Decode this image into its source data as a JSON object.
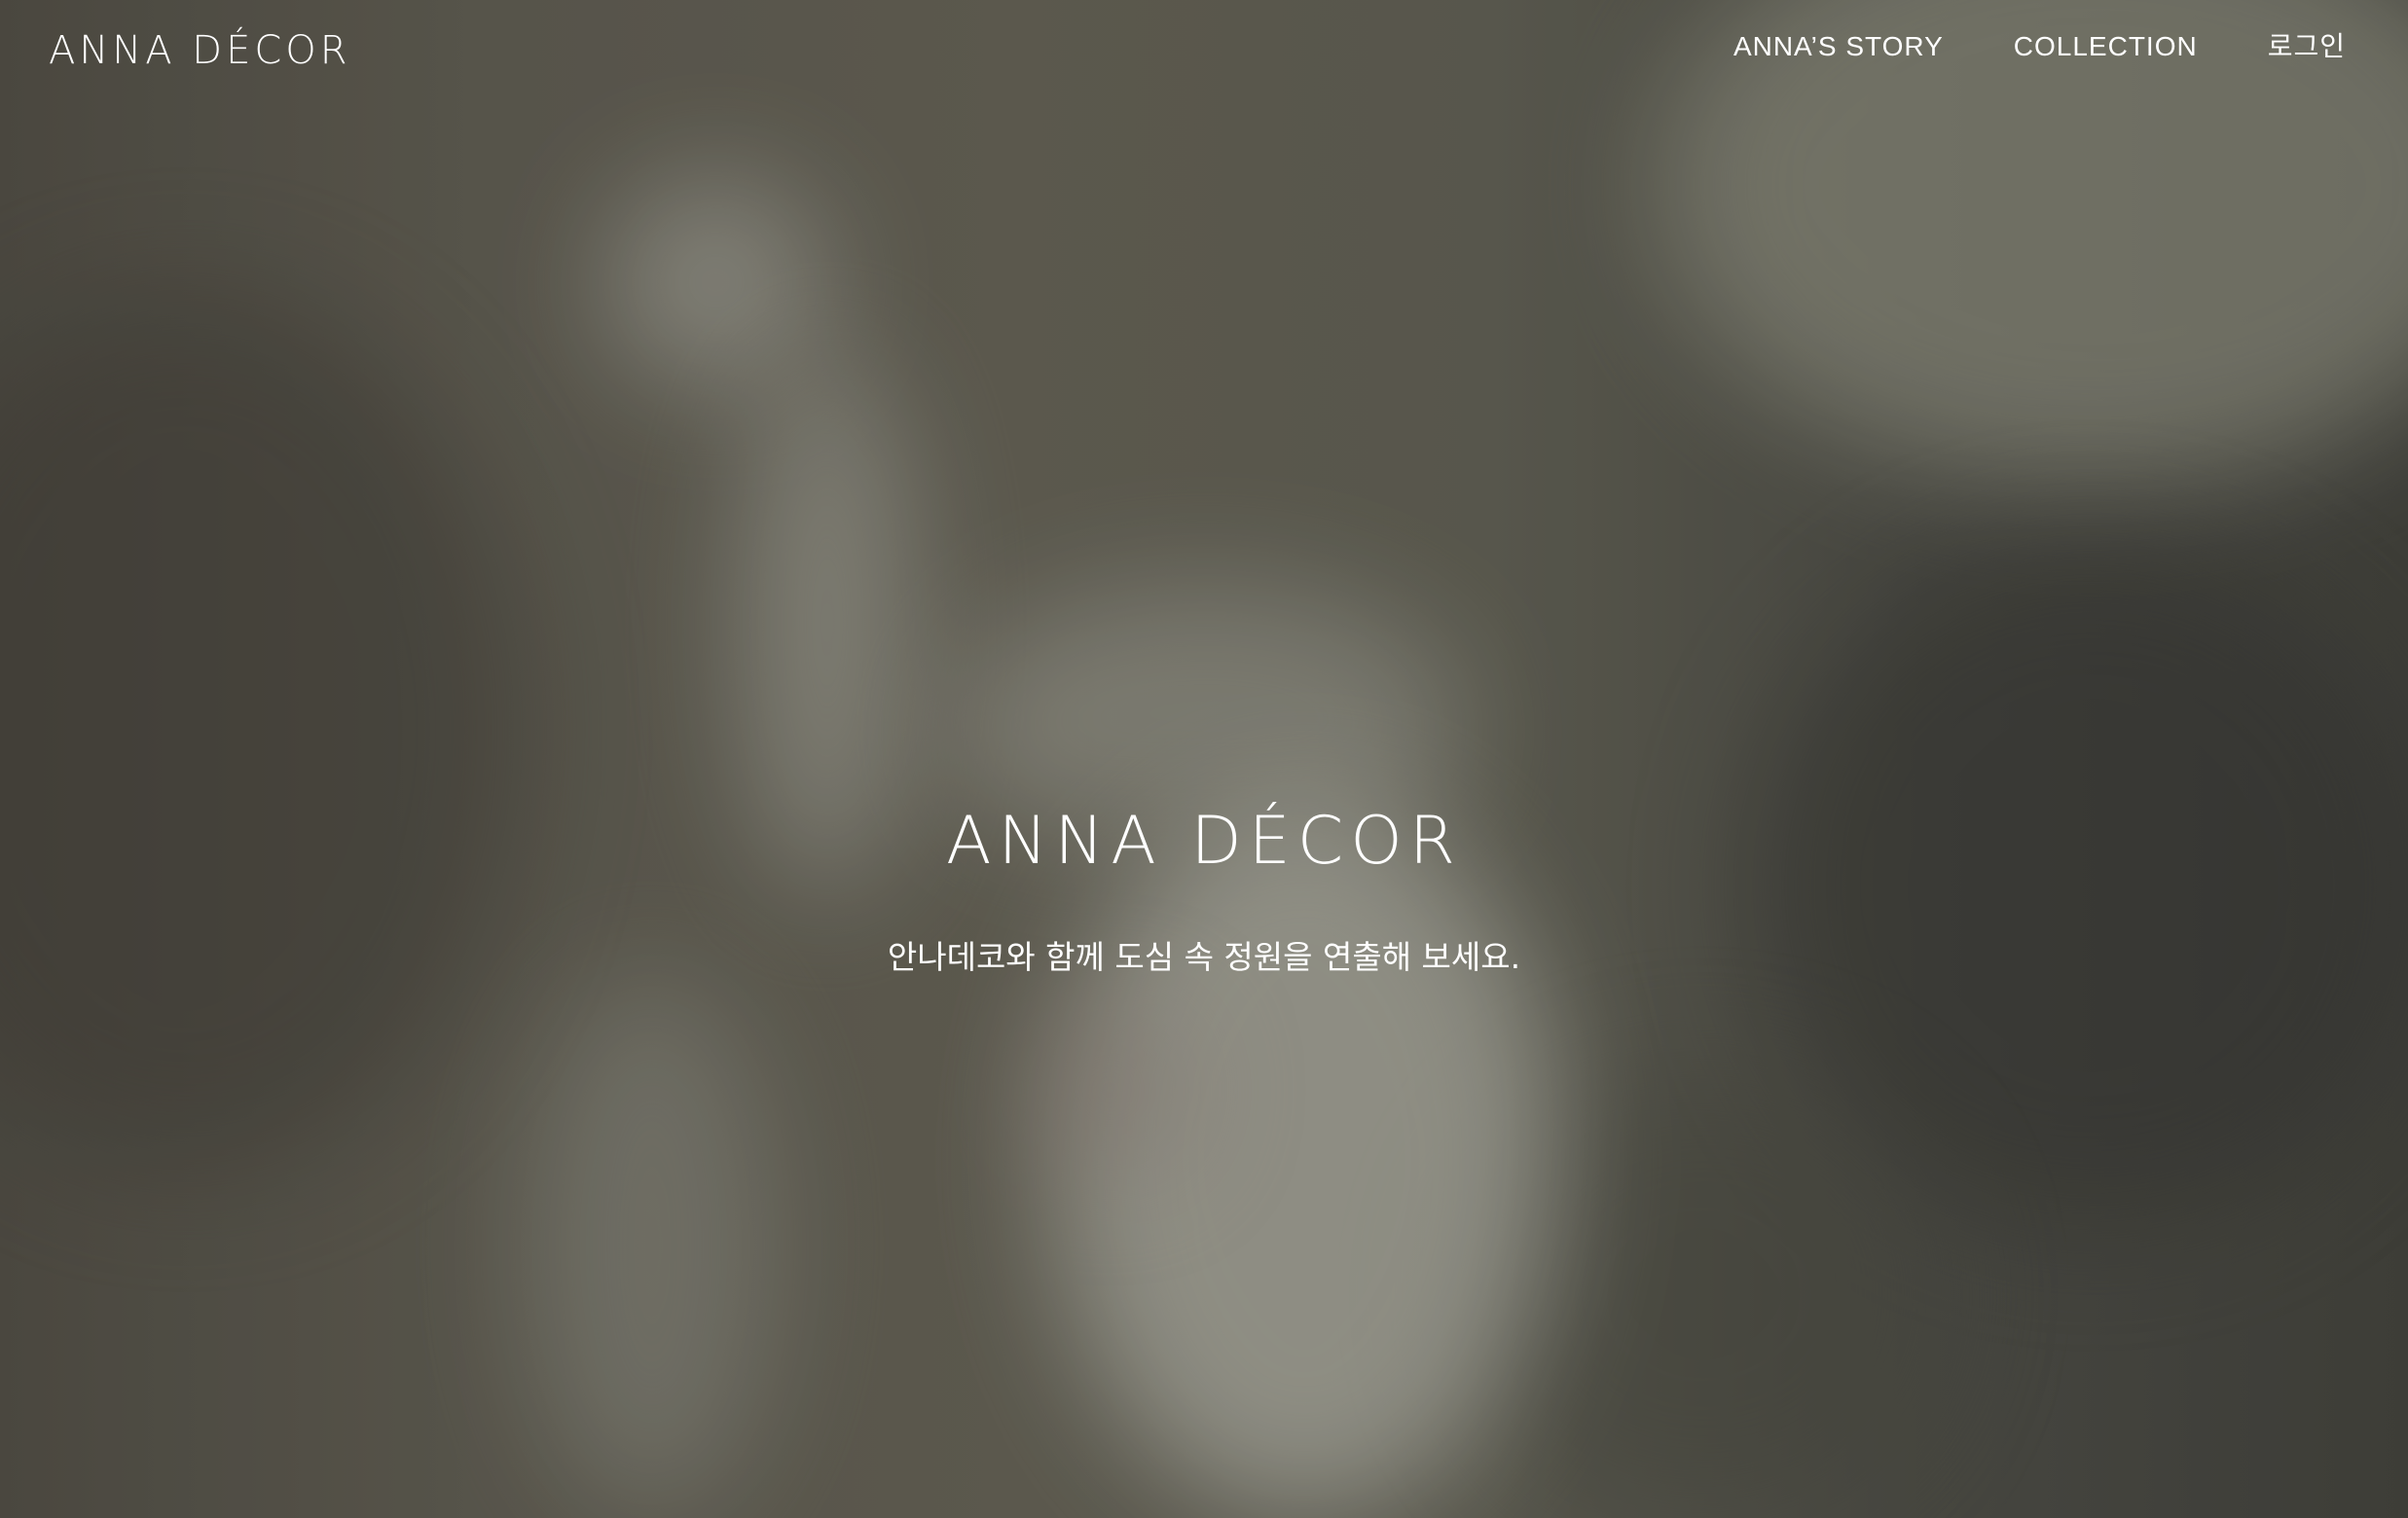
{
  "brand": {
    "logo_text": "ANNA DÉCOR"
  },
  "nav": {
    "items": [
      {
        "label": "ANNA’S STORY"
      },
      {
        "label": "COLLECTION"
      },
      {
        "label": "로그인"
      }
    ]
  },
  "hero": {
    "title": "ANNA DÉCOR",
    "tagline": "안나데코와 함께 도심 속 정원을 연출해 보세요."
  },
  "colors": {
    "text": "#ffffff",
    "background_tone": "#5d5a50"
  }
}
